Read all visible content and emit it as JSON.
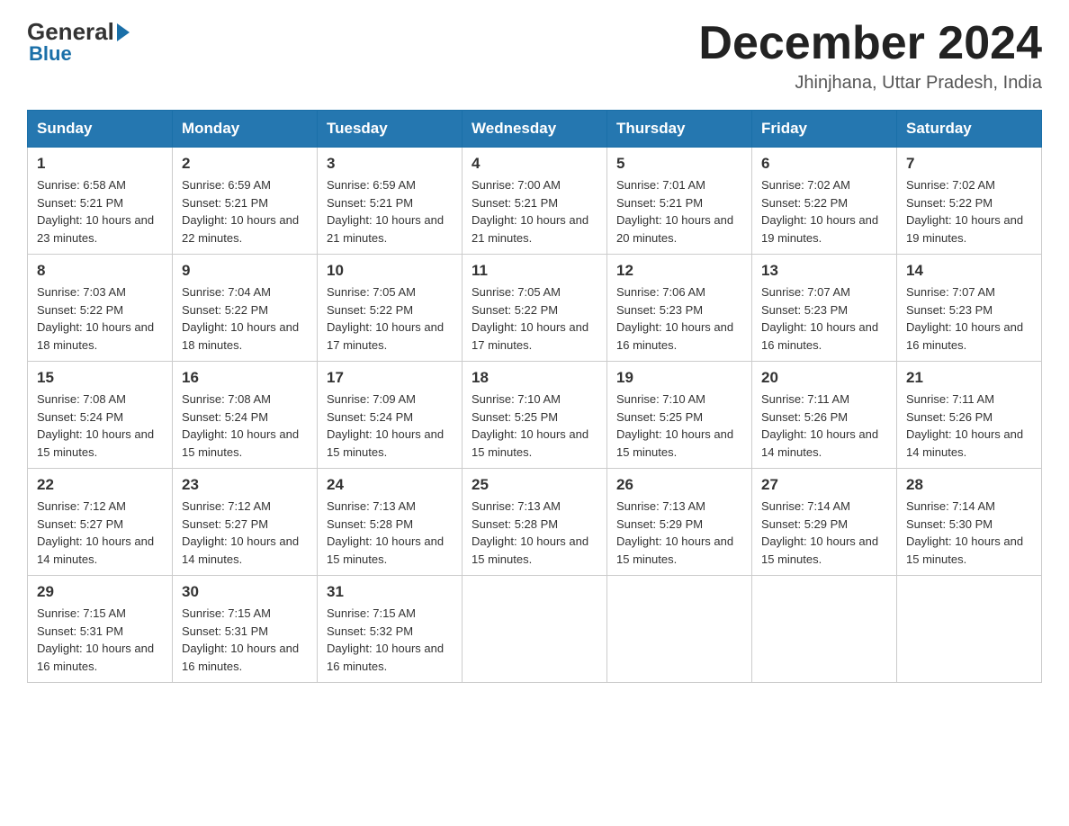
{
  "header": {
    "logo": {
      "general": "General",
      "blue": "Blue"
    },
    "title": "December 2024",
    "location": "Jhinjhana, Uttar Pradesh, India"
  },
  "calendar": {
    "weekdays": [
      "Sunday",
      "Monday",
      "Tuesday",
      "Wednesday",
      "Thursday",
      "Friday",
      "Saturday"
    ],
    "weeks": [
      [
        {
          "day": "1",
          "sunrise": "6:58 AM",
          "sunset": "5:21 PM",
          "daylight": "10 hours and 23 minutes."
        },
        {
          "day": "2",
          "sunrise": "6:59 AM",
          "sunset": "5:21 PM",
          "daylight": "10 hours and 22 minutes."
        },
        {
          "day": "3",
          "sunrise": "6:59 AM",
          "sunset": "5:21 PM",
          "daylight": "10 hours and 21 minutes."
        },
        {
          "day": "4",
          "sunrise": "7:00 AM",
          "sunset": "5:21 PM",
          "daylight": "10 hours and 21 minutes."
        },
        {
          "day": "5",
          "sunrise": "7:01 AM",
          "sunset": "5:21 PM",
          "daylight": "10 hours and 20 minutes."
        },
        {
          "day": "6",
          "sunrise": "7:02 AM",
          "sunset": "5:22 PM",
          "daylight": "10 hours and 19 minutes."
        },
        {
          "day": "7",
          "sunrise": "7:02 AM",
          "sunset": "5:22 PM",
          "daylight": "10 hours and 19 minutes."
        }
      ],
      [
        {
          "day": "8",
          "sunrise": "7:03 AM",
          "sunset": "5:22 PM",
          "daylight": "10 hours and 18 minutes."
        },
        {
          "day": "9",
          "sunrise": "7:04 AM",
          "sunset": "5:22 PM",
          "daylight": "10 hours and 18 minutes."
        },
        {
          "day": "10",
          "sunrise": "7:05 AM",
          "sunset": "5:22 PM",
          "daylight": "10 hours and 17 minutes."
        },
        {
          "day": "11",
          "sunrise": "7:05 AM",
          "sunset": "5:22 PM",
          "daylight": "10 hours and 17 minutes."
        },
        {
          "day": "12",
          "sunrise": "7:06 AM",
          "sunset": "5:23 PM",
          "daylight": "10 hours and 16 minutes."
        },
        {
          "day": "13",
          "sunrise": "7:07 AM",
          "sunset": "5:23 PM",
          "daylight": "10 hours and 16 minutes."
        },
        {
          "day": "14",
          "sunrise": "7:07 AM",
          "sunset": "5:23 PM",
          "daylight": "10 hours and 16 minutes."
        }
      ],
      [
        {
          "day": "15",
          "sunrise": "7:08 AM",
          "sunset": "5:24 PM",
          "daylight": "10 hours and 15 minutes."
        },
        {
          "day": "16",
          "sunrise": "7:08 AM",
          "sunset": "5:24 PM",
          "daylight": "10 hours and 15 minutes."
        },
        {
          "day": "17",
          "sunrise": "7:09 AM",
          "sunset": "5:24 PM",
          "daylight": "10 hours and 15 minutes."
        },
        {
          "day": "18",
          "sunrise": "7:10 AM",
          "sunset": "5:25 PM",
          "daylight": "10 hours and 15 minutes."
        },
        {
          "day": "19",
          "sunrise": "7:10 AM",
          "sunset": "5:25 PM",
          "daylight": "10 hours and 15 minutes."
        },
        {
          "day": "20",
          "sunrise": "7:11 AM",
          "sunset": "5:26 PM",
          "daylight": "10 hours and 14 minutes."
        },
        {
          "day": "21",
          "sunrise": "7:11 AM",
          "sunset": "5:26 PM",
          "daylight": "10 hours and 14 minutes."
        }
      ],
      [
        {
          "day": "22",
          "sunrise": "7:12 AM",
          "sunset": "5:27 PM",
          "daylight": "10 hours and 14 minutes."
        },
        {
          "day": "23",
          "sunrise": "7:12 AM",
          "sunset": "5:27 PM",
          "daylight": "10 hours and 14 minutes."
        },
        {
          "day": "24",
          "sunrise": "7:13 AM",
          "sunset": "5:28 PM",
          "daylight": "10 hours and 15 minutes."
        },
        {
          "day": "25",
          "sunrise": "7:13 AM",
          "sunset": "5:28 PM",
          "daylight": "10 hours and 15 minutes."
        },
        {
          "day": "26",
          "sunrise": "7:13 AM",
          "sunset": "5:29 PM",
          "daylight": "10 hours and 15 minutes."
        },
        {
          "day": "27",
          "sunrise": "7:14 AM",
          "sunset": "5:29 PM",
          "daylight": "10 hours and 15 minutes."
        },
        {
          "day": "28",
          "sunrise": "7:14 AM",
          "sunset": "5:30 PM",
          "daylight": "10 hours and 15 minutes."
        }
      ],
      [
        {
          "day": "29",
          "sunrise": "7:15 AM",
          "sunset": "5:31 PM",
          "daylight": "10 hours and 16 minutes."
        },
        {
          "day": "30",
          "sunrise": "7:15 AM",
          "sunset": "5:31 PM",
          "daylight": "10 hours and 16 minutes."
        },
        {
          "day": "31",
          "sunrise": "7:15 AM",
          "sunset": "5:32 PM",
          "daylight": "10 hours and 16 minutes."
        },
        null,
        null,
        null,
        null
      ]
    ]
  }
}
